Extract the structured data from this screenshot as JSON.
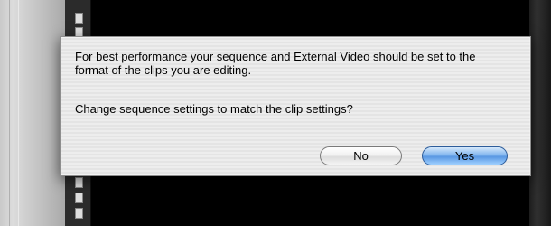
{
  "dialog": {
    "message": "For best performance your sequence and External Video should be set to the format of the clips you are editing.",
    "question": "Change sequence settings to match the clip settings?",
    "buttons": {
      "no": "No",
      "yes": "Yes"
    },
    "colors": {
      "default_button": "#5a98e3",
      "dialog_background": "#ececec"
    }
  }
}
